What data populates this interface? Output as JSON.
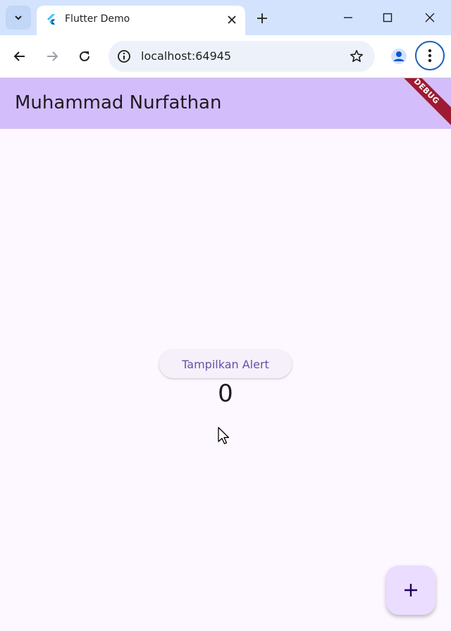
{
  "browser": {
    "tab": {
      "title": "Flutter Demo"
    },
    "address_bar": {
      "url": "localhost:64945"
    },
    "icons": [
      "tab-search-icon",
      "flutter-logo-icon",
      "close-icon",
      "plus-icon",
      "minimize-icon",
      "maximize-icon",
      "close-window-icon",
      "back-arrow-icon",
      "forward-arrow-icon",
      "reload-icon",
      "info-icon",
      "star-icon",
      "profile-icon",
      "more-vert-icon"
    ]
  },
  "app": {
    "appbar": {
      "title": "Muhammad Nurfathan",
      "debug_banner": "DEBUG"
    },
    "alert_button": {
      "label": "Tampilkan Alert"
    },
    "counter": {
      "value": "0"
    },
    "fab": {
      "icon": "add-icon"
    },
    "colors": {
      "appbar": "#d4bdfb",
      "background": "#fdf7ff",
      "primary": "#6750a4",
      "fab": "#eaddff",
      "debug_banner": "#9e1b32"
    }
  }
}
